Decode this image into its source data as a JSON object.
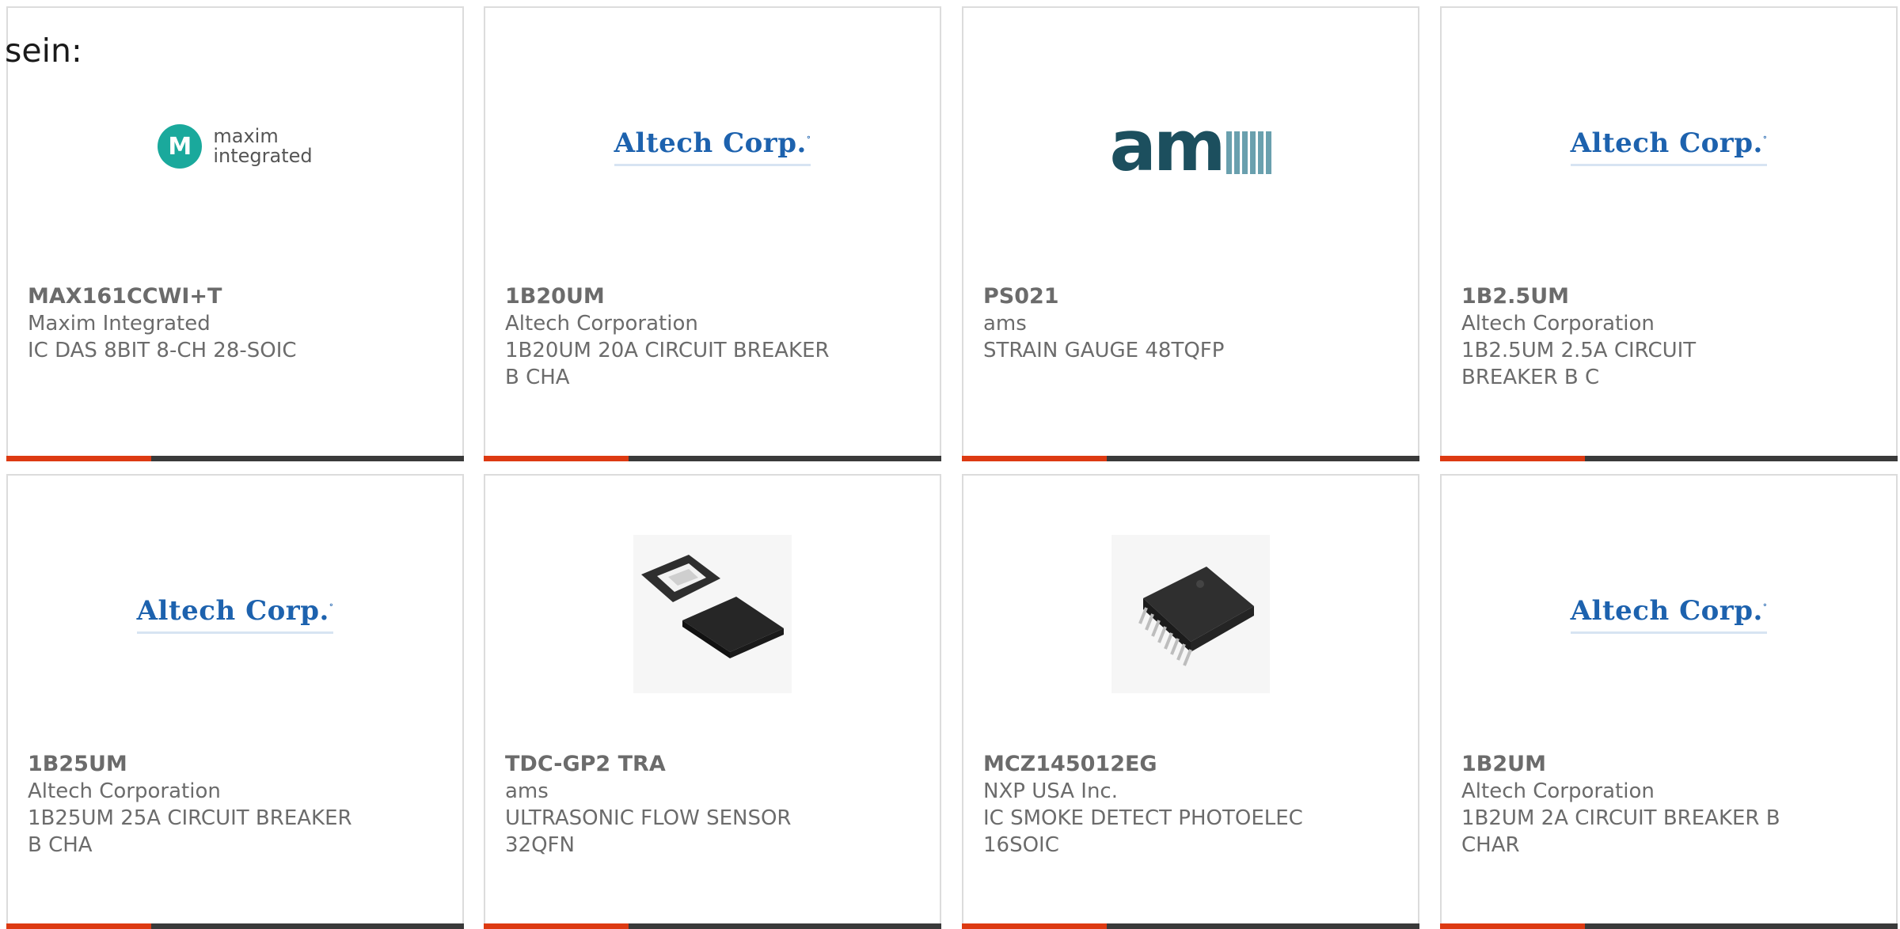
{
  "intro_text": "sein:",
  "colors": {
    "accent": "#dd3a12",
    "bar": "#3a3a3a",
    "card_border": "#dcdcdc",
    "text": "#6b6b6b"
  },
  "products": [
    {
      "part_number": "MAX161CCWI+T",
      "manufacturer": "Maxim Integrated",
      "description": "IC DAS 8BIT 8-CH 28-SOIC",
      "logo": "maxim-integrated-logo",
      "logo_text": [
        "maxim",
        "integrated"
      ]
    },
    {
      "part_number": "1B20UM",
      "manufacturer": "Altech Corporation",
      "description": "1B20UM 20A CIRCUIT BREAKER B CHA",
      "logo": "altech-corp-logo",
      "logo_text": "Altech Corp."
    },
    {
      "part_number": "PS021",
      "manufacturer": "ams",
      "description": "STRAIN GAUGE 48TQFP",
      "logo": "ams-logo",
      "logo_text": "am"
    },
    {
      "part_number": "1B2.5UM",
      "manufacturer": "Altech Corporation",
      "description": "1B2.5UM 2.5A CIRCUIT BREAKER B C",
      "logo": "altech-corp-logo",
      "logo_text": "Altech Corp."
    },
    {
      "part_number": "1B25UM",
      "manufacturer": "Altech Corporation",
      "description": "1B25UM 25A CIRCUIT BREAKER B CHA",
      "logo": "altech-corp-logo",
      "logo_text": "Altech Corp."
    },
    {
      "part_number": "TDC-GP2 TRA",
      "manufacturer": "ams",
      "description": "ULTRASONIC FLOW SENSOR 32QFN",
      "logo": "qfn-chip-photo"
    },
    {
      "part_number": "MCZ145012EG",
      "manufacturer": "NXP USA Inc.",
      "description": "IC SMOKE DETECT PHOTOELEC 16SOIC",
      "logo": "soic-chip-photo"
    },
    {
      "part_number": "1B2UM",
      "manufacturer": "Altech Corporation",
      "description": "1B2UM 2A CIRCUIT BREAKER B CHAR",
      "logo": "altech-corp-logo",
      "logo_text": "Altech Corp."
    }
  ]
}
